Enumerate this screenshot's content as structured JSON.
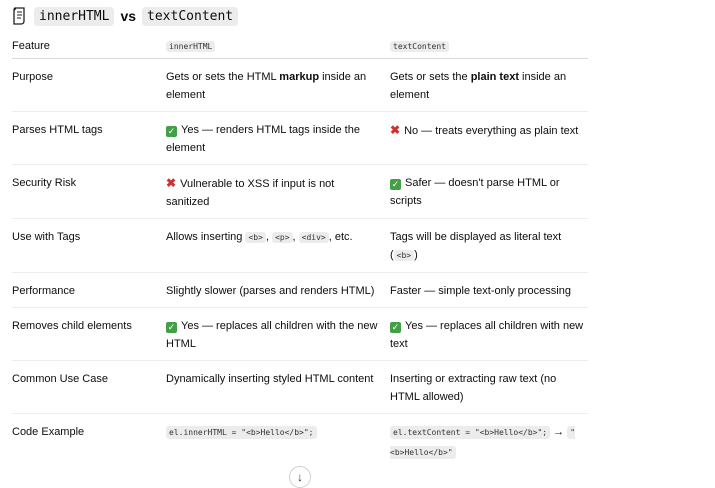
{
  "title": {
    "left": "innerHTML",
    "vs": "vs",
    "right": "textContent"
  },
  "headers": {
    "feature": "Feature",
    "inner": "innerHTML",
    "text": "textContent"
  },
  "rows": {
    "purpose": {
      "feature": "Purpose",
      "inner_pre": "Gets or sets the HTML ",
      "inner_bold": "markup",
      "inner_post": " inside an element",
      "text_pre": "Gets or sets the ",
      "text_bold": "plain text",
      "text_post": " inside an element"
    },
    "parses": {
      "feature": "Parses HTML tags",
      "inner": "Yes — renders HTML tags inside the element",
      "text": "No — treats everything as plain text"
    },
    "security": {
      "feature": "Security Risk",
      "inner": "Vulnerable to XSS if input is not sanitized",
      "text": "Safer — doesn't parse HTML or scripts"
    },
    "tags": {
      "feature": "Use with Tags",
      "inner_pre": "Allows inserting ",
      "tag_b": "<b>",
      "sep1": ", ",
      "tag_p": "<p>",
      "sep2": ", ",
      "tag_div": "<div>",
      "inner_post": ", etc.",
      "text_pre": "Tags will be displayed as literal text (",
      "text_tag": "<b>",
      "text_post": ")"
    },
    "performance": {
      "feature": "Performance",
      "inner": "Slightly slower (parses and renders HTML)",
      "text": "Faster — simple text-only processing"
    },
    "removes": {
      "feature": "Removes child elements",
      "inner": "Yes — replaces all children with the new HTML",
      "text": "Yes — replaces all children with new text"
    },
    "usecase": {
      "feature": "Common Use Case",
      "inner": "Dynamically inserting styled HTML content",
      "text": "Inserting or extracting raw text (no HTML allowed)"
    },
    "code": {
      "feature": "Code Example",
      "inner": "el.innerHTML = \"<b>Hello</b>\";",
      "text": "el.textContent = \"<b>Hello</b>\";",
      "arrow": " → ",
      "result": "\"<b>Hello</b>\""
    }
  },
  "icons": {
    "doc": "document-icon",
    "check": "check-mark-icon",
    "cross": "cross-mark-icon",
    "scroll": "arrow-down-icon"
  },
  "colors": {
    "check_green": "#43a047",
    "cross_red": "#d32f2f"
  },
  "glyphs": {
    "check": "✓",
    "cross": "✖",
    "arrow_down": "↓"
  }
}
